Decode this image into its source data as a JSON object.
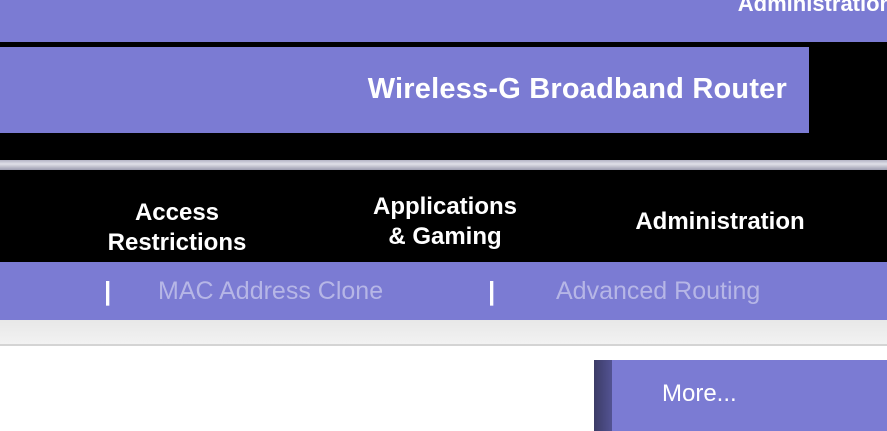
{
  "header": {
    "clipped_label": "Administration",
    "product_title": "Wireless-G Broadband Router"
  },
  "nav": {
    "tabs": [
      {
        "line1": "Access",
        "line2": "Restrictions"
      },
      {
        "line1": "Applications",
        "line2": "& Gaming"
      },
      {
        "line1": "Administration",
        "line2": ""
      }
    ]
  },
  "subnav": {
    "separator": "|",
    "links": [
      "MAC Address Clone",
      "Advanced Routing"
    ]
  },
  "more": {
    "label": "More..."
  },
  "colors": {
    "brand_purple": "#7b7bd3",
    "nav_black": "#000000",
    "inactive_link": "#b6b6e6"
  }
}
